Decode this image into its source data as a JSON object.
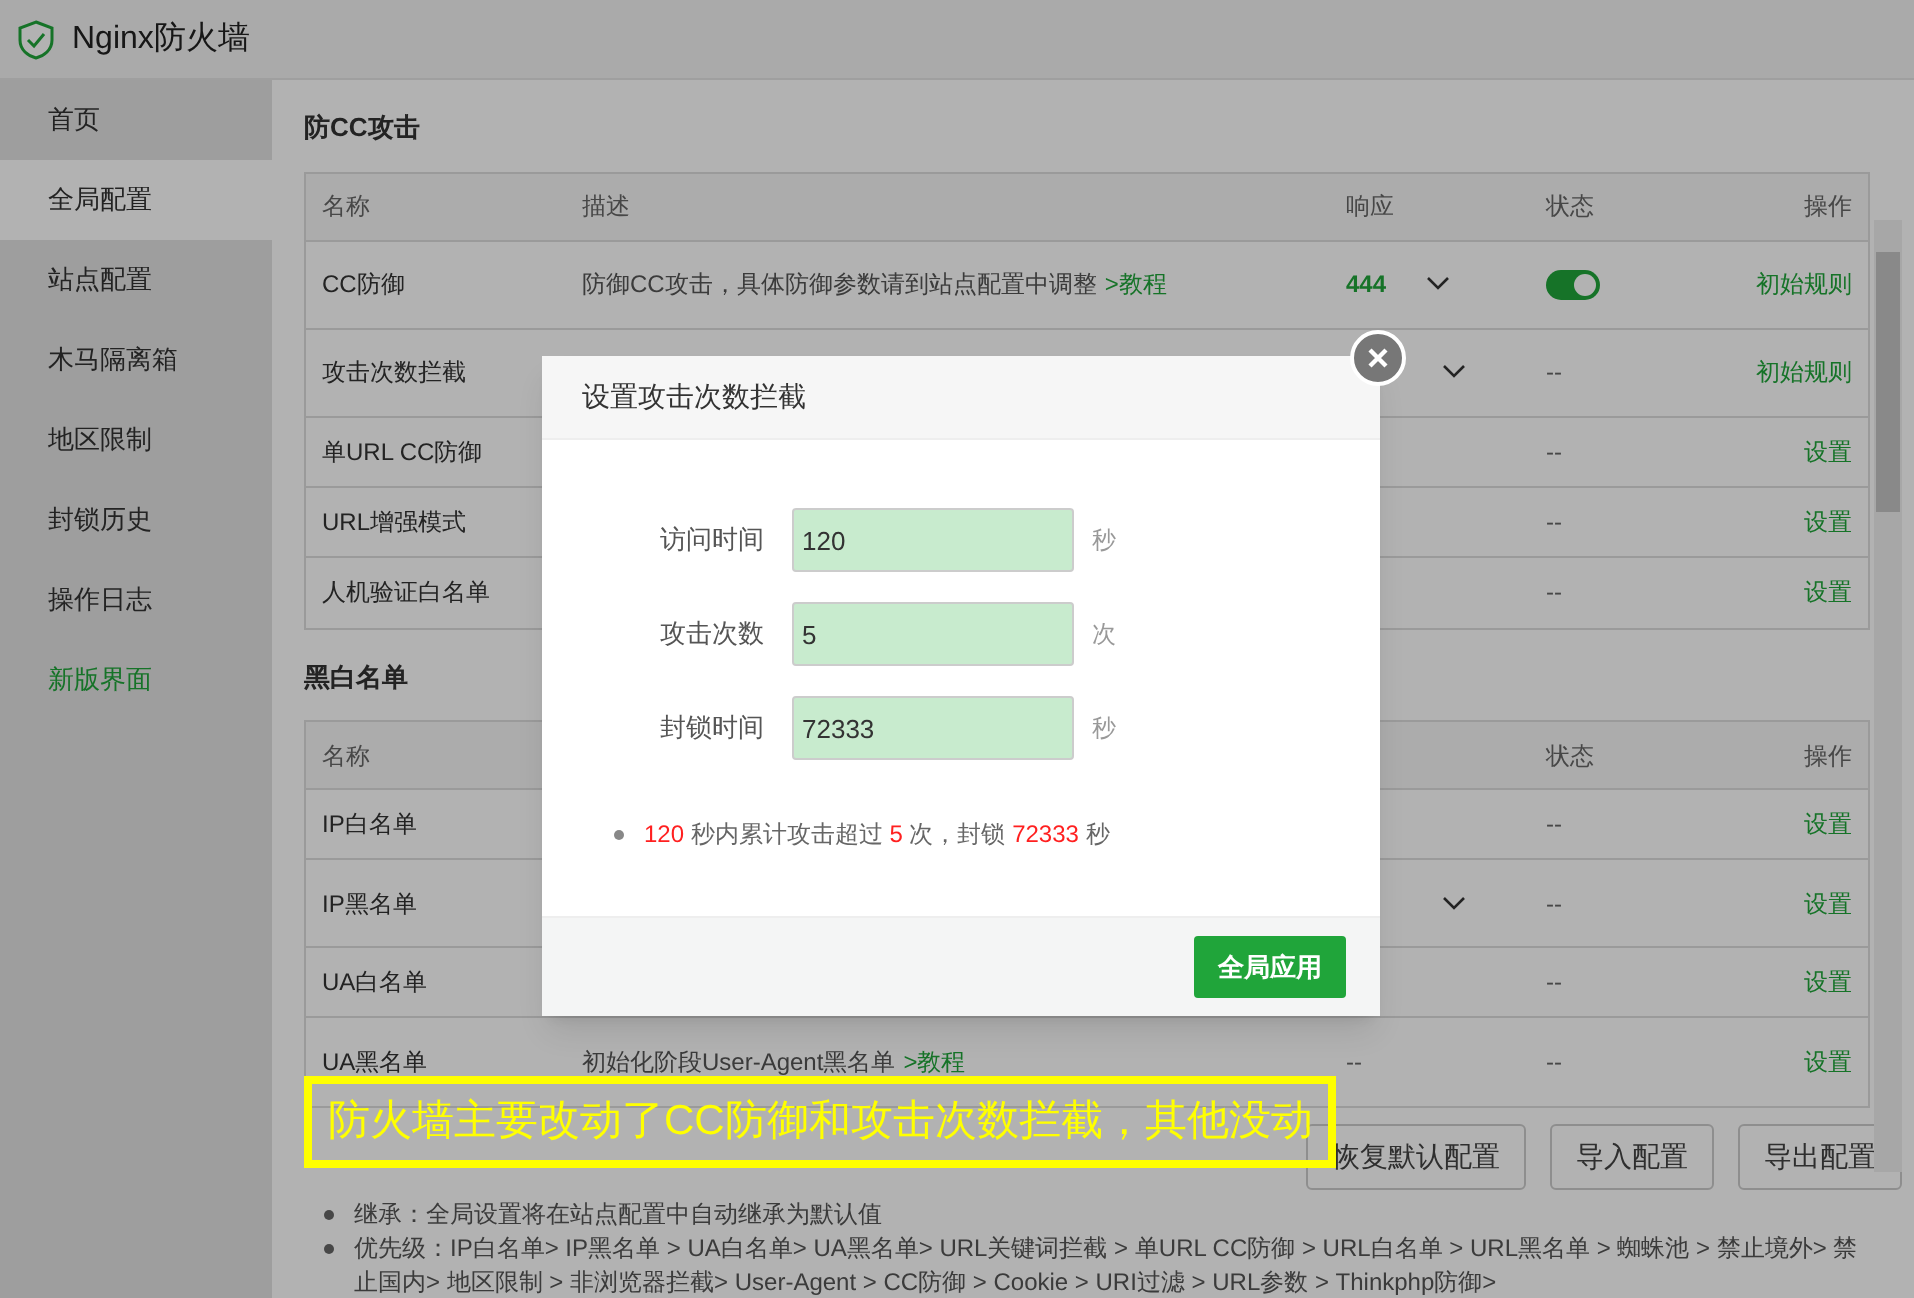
{
  "window": {
    "title": "Nginx防火墙"
  },
  "sidebar": {
    "items": [
      {
        "label": "首页",
        "selected": false,
        "kind": "normal"
      },
      {
        "label": "全局配置",
        "selected": true,
        "kind": "normal"
      },
      {
        "label": "站点配置",
        "selected": false,
        "kind": "normal"
      },
      {
        "label": "木马隔离箱",
        "selected": false,
        "kind": "normal"
      },
      {
        "label": "地区限制",
        "selected": false,
        "kind": "normal"
      },
      {
        "label": "封锁历史",
        "selected": false,
        "kind": "normal"
      },
      {
        "label": "操作日志",
        "selected": false,
        "kind": "normal"
      },
      {
        "label": "新版界面",
        "selected": false,
        "kind": "highlight"
      }
    ]
  },
  "sections": [
    {
      "title": "防CC攻击",
      "columns": [
        "名称",
        "描述",
        "响应",
        "状态",
        "操作"
      ],
      "rows": [
        {
          "name": "CC防御",
          "description": "防御CC攻击，具体防御参数请到站点配置中调整",
          "link": ">教程",
          "response": "444",
          "dropdown": true,
          "on": true,
          "action": "初始规则"
        },
        {
          "name": "攻击次数拦截",
          "dropdown": true,
          "status": "--",
          "action": "初始规则"
        },
        {
          "name": "单URL CC防御",
          "status": "--",
          "action": "设置"
        },
        {
          "name": "URL增强模式",
          "status": "--",
          "action": "设置"
        },
        {
          "name": "人机验证白名单",
          "status": "--",
          "action": "设置"
        }
      ]
    },
    {
      "title": "黑白名单",
      "columns": [
        "名称",
        null,
        null,
        "状态",
        "操作"
      ],
      "rows": [
        {
          "name": "IP白名单",
          "status": "--",
          "action": "设置"
        },
        {
          "name": "IP黑名单",
          "dropdown": true,
          "status": "--",
          "action": "设置"
        },
        {
          "name": "UA白名单",
          "status": "--",
          "action": "设置"
        },
        {
          "name": "UA黑名单",
          "description": "初始化阶段User-Agent黑名单",
          "link": ">教程",
          "response": "--",
          "status": "--",
          "action": "设置"
        }
      ]
    }
  ],
  "buttons": [
    "恢复默认配置",
    "导入配置",
    "导出配置"
  ],
  "notes": [
    "继承：全局设置将在站点配置中自动继承为默认值",
    "优先级：IP白名单> IP黑名单 > UA白名单> UA黑名单> URL关键词拦截 > 单URL CC防御 > URL白名单 > URL黑名单 > 蜘蛛池 > 禁止境外> 禁止国内> 地区限制 > 非浏览器拦截> User-Agent > CC防御 > Cookie > URI过滤 > URL参数 > Thinkphp防御>"
  ],
  "dialog": {
    "title": "设置攻击次数拦截",
    "fields": [
      {
        "label": "访问时间",
        "value": "120",
        "unit": "秒"
      },
      {
        "label": "攻击次数",
        "value": "5",
        "unit": "次"
      },
      {
        "label": "封锁时间",
        "value": "72333",
        "unit": "秒"
      }
    ],
    "summary": [
      {
        "kind": "value",
        "text": "120"
      },
      {
        "kind": "text",
        "text": "秒内累计攻击超过"
      },
      {
        "kind": "value",
        "text": "5"
      },
      {
        "kind": "text",
        "text": "次，封锁"
      },
      {
        "kind": "value",
        "text": "72333"
      },
      {
        "kind": "text",
        "text": "秒"
      }
    ],
    "button": "全局应用"
  },
  "caption": "防火墙主要改动了CC防御和攻击次数拦截，其他没动"
}
